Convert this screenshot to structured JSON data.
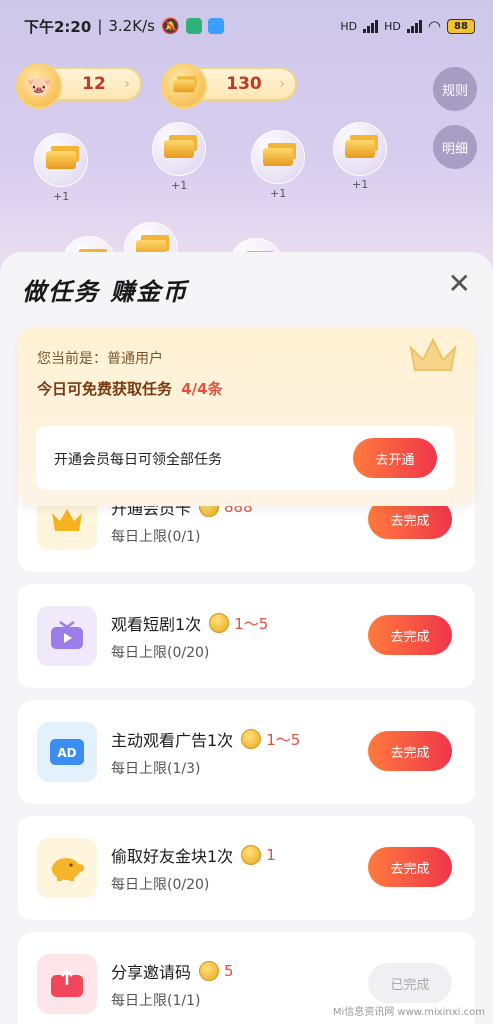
{
  "status": {
    "time": "下午2:20",
    "speed": "3.2K/s",
    "battery": "88",
    "hd": "HD"
  },
  "counters": {
    "piggy": "12",
    "gold": "130"
  },
  "side_buttons": {
    "rules": "规则",
    "detail": "明细"
  },
  "bubbles": {
    "plus": "+1"
  },
  "sheet": {
    "title": "做任务  赚金币",
    "user_line": "您当前是：普通用户",
    "free_tasks_prefix": "今日可免费获取任务",
    "free_tasks_count": "4/4条",
    "vip_text": "开通会员每日可领全部任务",
    "vip_button": "去开通"
  },
  "tasks": [
    {
      "name": "开通会员卡",
      "reward": "888",
      "limit": "每日上限(0/1)",
      "button": "去完成",
      "icon": "crown-icon"
    },
    {
      "name": "观看短剧1次",
      "reward": "1～5",
      "limit": "每日上限(0/20)",
      "button": "去完成",
      "icon": "tv-icon"
    },
    {
      "name": "主动观看广告1次",
      "reward": "1～5",
      "limit": "每日上限(1/3)",
      "button": "去完成",
      "icon": "ad-icon"
    },
    {
      "name": "偷取好友金块1次",
      "reward": "1",
      "limit": "每日上限(0/20)",
      "button": "去完成",
      "icon": "piggy-icon"
    },
    {
      "name": "分享邀请码",
      "reward": "5",
      "limit": "每日上限(1/1)",
      "button": "已完成",
      "icon": "share-icon"
    }
  ],
  "watermark": "Mi信息资讯网 www.mixinxi.com"
}
